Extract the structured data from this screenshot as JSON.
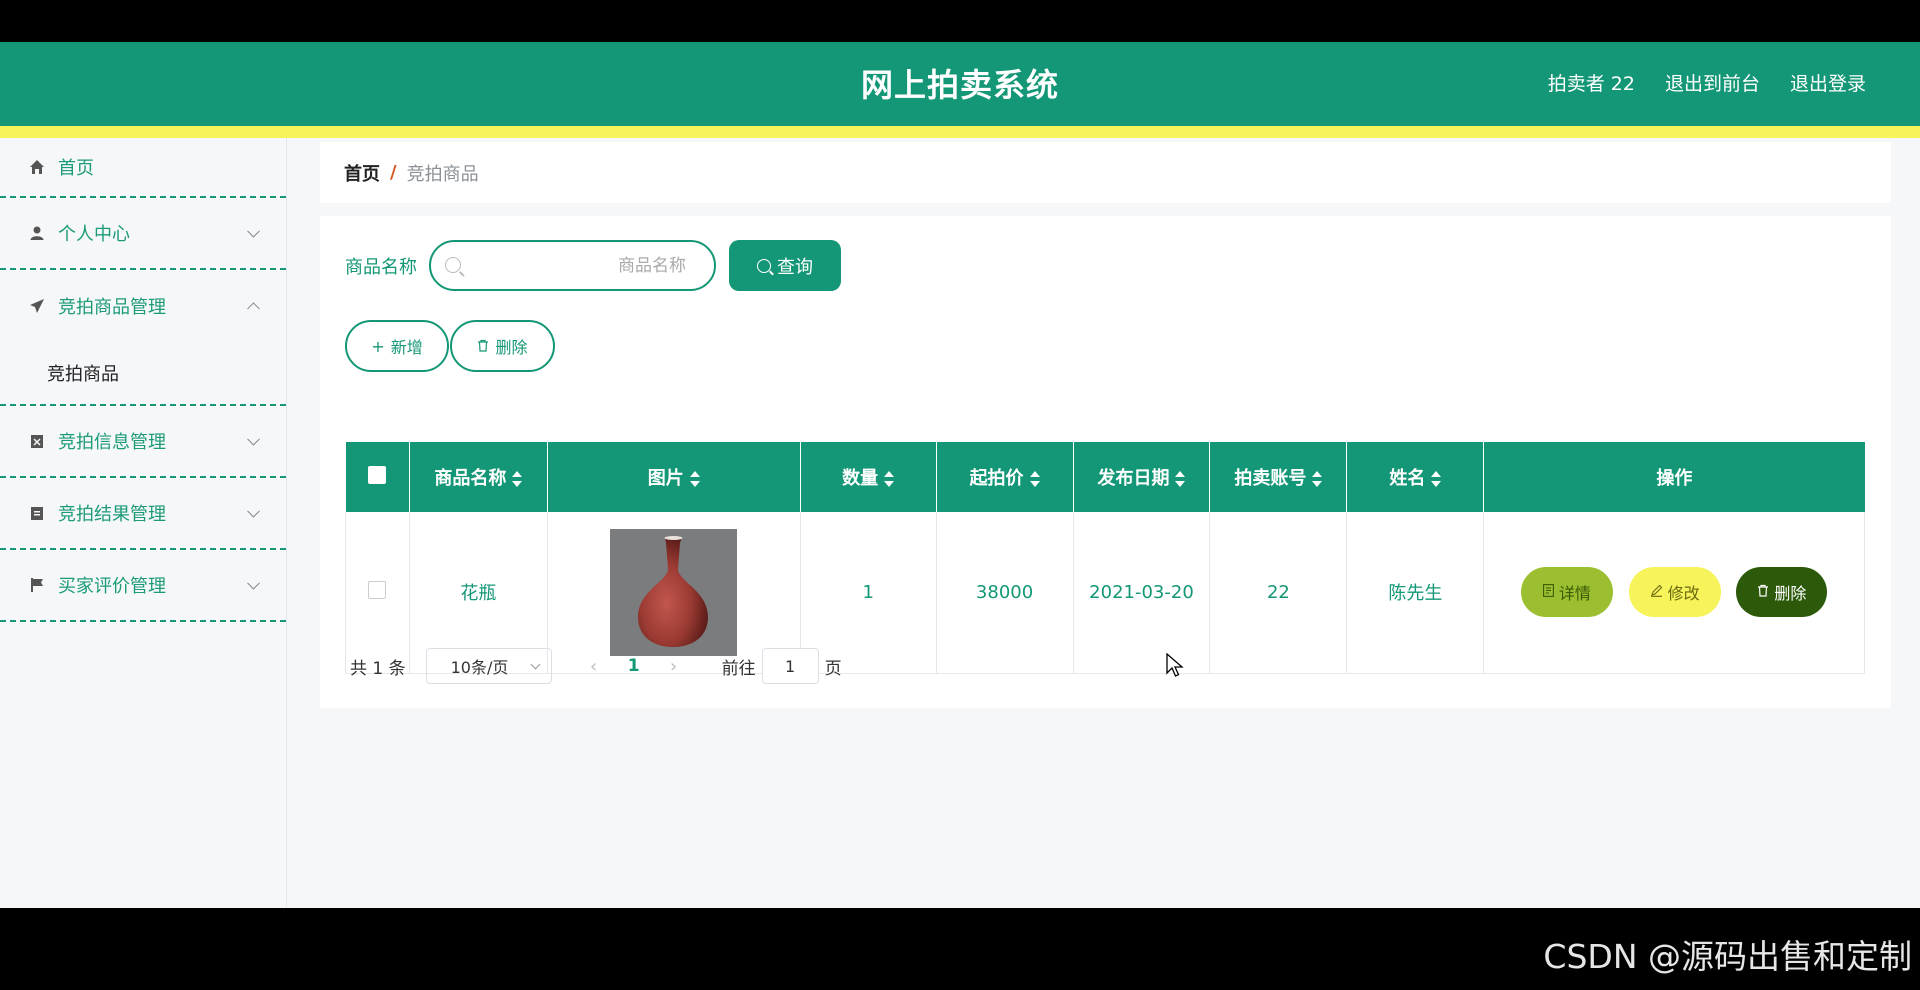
{
  "header": {
    "title": "网上拍卖系统",
    "user": "拍卖者 22",
    "exit_front": "退出到前台",
    "logout": "退出登录"
  },
  "sidebar": {
    "items": [
      {
        "label": "首页",
        "icon": "home-icon"
      },
      {
        "label": "个人中心",
        "icon": "user-icon"
      },
      {
        "label": "竞拍商品管理",
        "icon": "paper-plane-icon",
        "expanded": true,
        "children": [
          {
            "label": "竞拍商品"
          }
        ]
      },
      {
        "label": "竞拍信息管理",
        "icon": "clipboard-x-icon"
      },
      {
        "label": "竞拍结果管理",
        "icon": "clipboard-icon"
      },
      {
        "label": "买家评价管理",
        "icon": "flag-icon"
      }
    ]
  },
  "breadcrumb": {
    "home": "首页",
    "sep": "/",
    "current": "竞拍商品"
  },
  "search": {
    "label": "商品名称",
    "placeholder": "商品名称",
    "query_label": "查询"
  },
  "actions": {
    "add_label": "新增",
    "delete_label": "删除"
  },
  "table": {
    "columns": [
      "商品名称",
      "图片",
      "数量",
      "起拍价",
      "发布日期",
      "拍卖账号",
      "姓名",
      "操作"
    ],
    "rows": [
      {
        "name": "花瓶",
        "image": "vase-photo",
        "quantity": "1",
        "start_price": "38000",
        "date": "2021-03-20",
        "account": "22",
        "person": "陈先生"
      }
    ],
    "row_actions": {
      "detail": "详情",
      "edit": "修改",
      "delete": "删除"
    }
  },
  "pagination": {
    "total": "共 1 条",
    "page_size": "10条/页",
    "current_page": "1",
    "goto_prefix": "前往",
    "goto_value": "1",
    "goto_suffix": "页"
  },
  "watermark": "CSDN @源码出售和定制",
  "colors": {
    "primary": "#149776",
    "accent_yellow": "#f6f35b",
    "detail_green": "#9bbf30",
    "dark_green": "#2d5a0a"
  }
}
